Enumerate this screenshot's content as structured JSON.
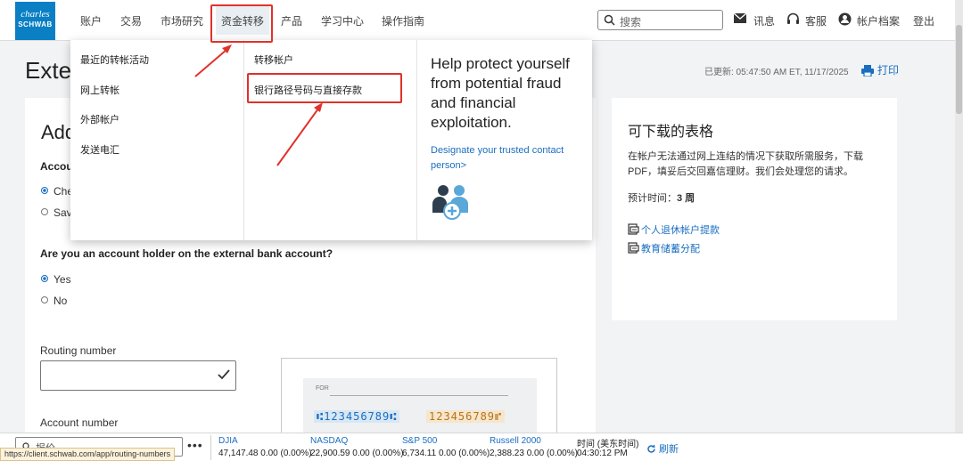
{
  "logo": {
    "line1": "charles",
    "line2": "SCHWAB"
  },
  "nav": {
    "items": [
      "账户",
      "交易",
      "市场研究",
      "资金转移",
      "产品",
      "学习中心",
      "操作指南"
    ],
    "active": "资金转移"
  },
  "search": {
    "placeholder": "搜索"
  },
  "utility": {
    "messages": "讯息",
    "support": "客服",
    "profile": "帐户档案",
    "logout": "登出"
  },
  "page": {
    "title_visible": "Exter",
    "updated": "已更新: 05:47:50 AM ET, 11/17/2025",
    "print": "打印"
  },
  "form": {
    "heading_visible": "Add",
    "account_type_label": "Accou",
    "account_types": [
      "Che",
      "Sav"
    ],
    "holder_question": "Are you an account holder on the external bank account?",
    "holder_options": [
      "Yes",
      "No"
    ],
    "routing_label": "Routing number",
    "account_label": "Account number",
    "check_for": "FOR",
    "micr_routing": "⑆123456789⑆",
    "micr_account": "123456789⑈"
  },
  "side": {
    "title": "可下载的表格",
    "desc": "在帐户无法通过网上连结的情况下获取所需服务，下载PDF，填妥后交回嘉信理财。我们会处理您的请求。",
    "time_label": "预计时间：",
    "time_value": "3 周",
    "links": [
      "个人退休帐户提款",
      "教育储蓄分配"
    ]
  },
  "mega_menu": {
    "col1": [
      "最近的转帐活动",
      "网上转帐",
      "外部帐户",
      "发送电汇"
    ],
    "col2": [
      "转移帐户",
      "银行路径号码与直接存款"
    ],
    "promo_heading": "Help protect yourself from potential fraud and financial exploitation.",
    "promo_link": "Designate your trusted contact person>"
  },
  "ticker": {
    "quote_placeholder": "报价",
    "indices": [
      {
        "name": "DJIA",
        "value": "47,147.48 0.00 (0.00%)"
      },
      {
        "name": "NASDAQ",
        "value": "22,900.59 0.00 (0.00%)"
      },
      {
        "name": "S&P 500",
        "value": "6,734.11 0.00 (0.00%)"
      },
      {
        "name": "Russell 2000",
        "value": "2,388.23 0.00 (0.00%)"
      }
    ],
    "time_label": "时间 (美东时间)",
    "time_value": "04:30:12 PM",
    "refresh": "刷新"
  },
  "status_url": "https://client.schwab.com/app/routing-numbers",
  "colors": {
    "brand": "#0a7fc4",
    "link": "#1a6ec1",
    "highlight": "#e0322a"
  }
}
